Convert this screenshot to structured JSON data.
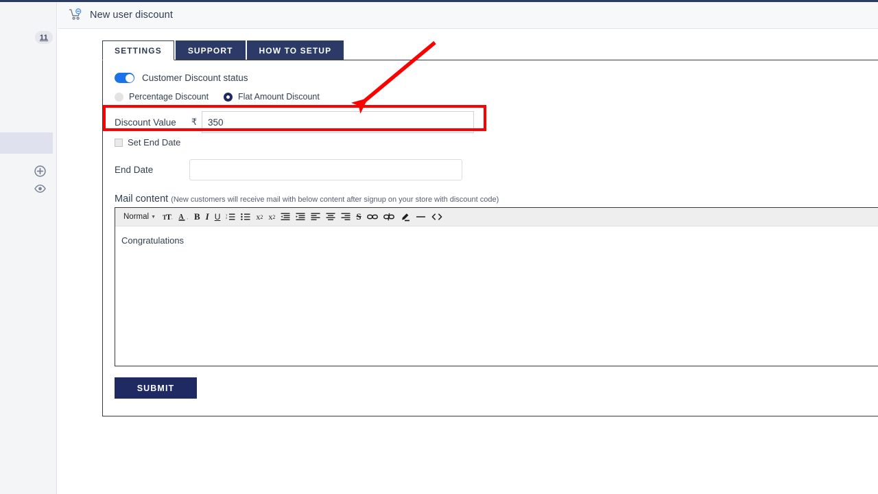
{
  "header": {
    "title": "New user discount",
    "icon": "shopping-cart-icon"
  },
  "sidebar": {
    "badge_count": "11",
    "icons": [
      "plus-circle-icon",
      "eye-icon"
    ]
  },
  "tabs": [
    {
      "label": "SETTINGS",
      "active": true
    },
    {
      "label": "SUPPORT",
      "active": false
    },
    {
      "label": "HOW TO SETUP",
      "active": false
    }
  ],
  "form": {
    "status_toggle_label": "Customer Discount status",
    "status_toggle_on": true,
    "discount_type_options": [
      {
        "label": "Percentage Discount",
        "selected": false
      },
      {
        "label": "Flat Amount Discount",
        "selected": true
      }
    ],
    "discount_value_label": "Discount Value",
    "currency_symbol": "₹",
    "discount_value": "350",
    "discount_value_placeholder": "",
    "set_end_date_label": "Set End Date",
    "set_end_date_checked": false,
    "end_date_label": "End Date",
    "end_date_value": "",
    "end_date_placeholder": "",
    "mail_content_title": "Mail content",
    "mail_content_note": "(New customers will receive mail with below content after signup on your store with discount code)",
    "submit_label": "SUBMIT"
  },
  "editor": {
    "format_selected": "Normal",
    "body_text": "Congratulations",
    "toolbar_items": [
      "font-size-icon",
      "text-color-icon",
      "bold-icon",
      "italic-icon",
      "underline-icon",
      "ordered-list-icon",
      "bullet-list-icon",
      "subscript-icon",
      "superscript-icon",
      "indent-decrease-icon",
      "indent-increase-icon",
      "align-left-icon",
      "align-center-icon",
      "align-right-icon",
      "strikethrough-icon",
      "link-icon",
      "unlink-icon",
      "highlight-icon",
      "horizontal-rule-icon",
      "code-icon"
    ]
  },
  "colors": {
    "brand_navy": "#2b3a67",
    "submit_navy": "#1f2a63",
    "toggle_blue": "#1a73e8",
    "radio_navy": "#1c2a60",
    "annotation_red": "#ff0000"
  }
}
